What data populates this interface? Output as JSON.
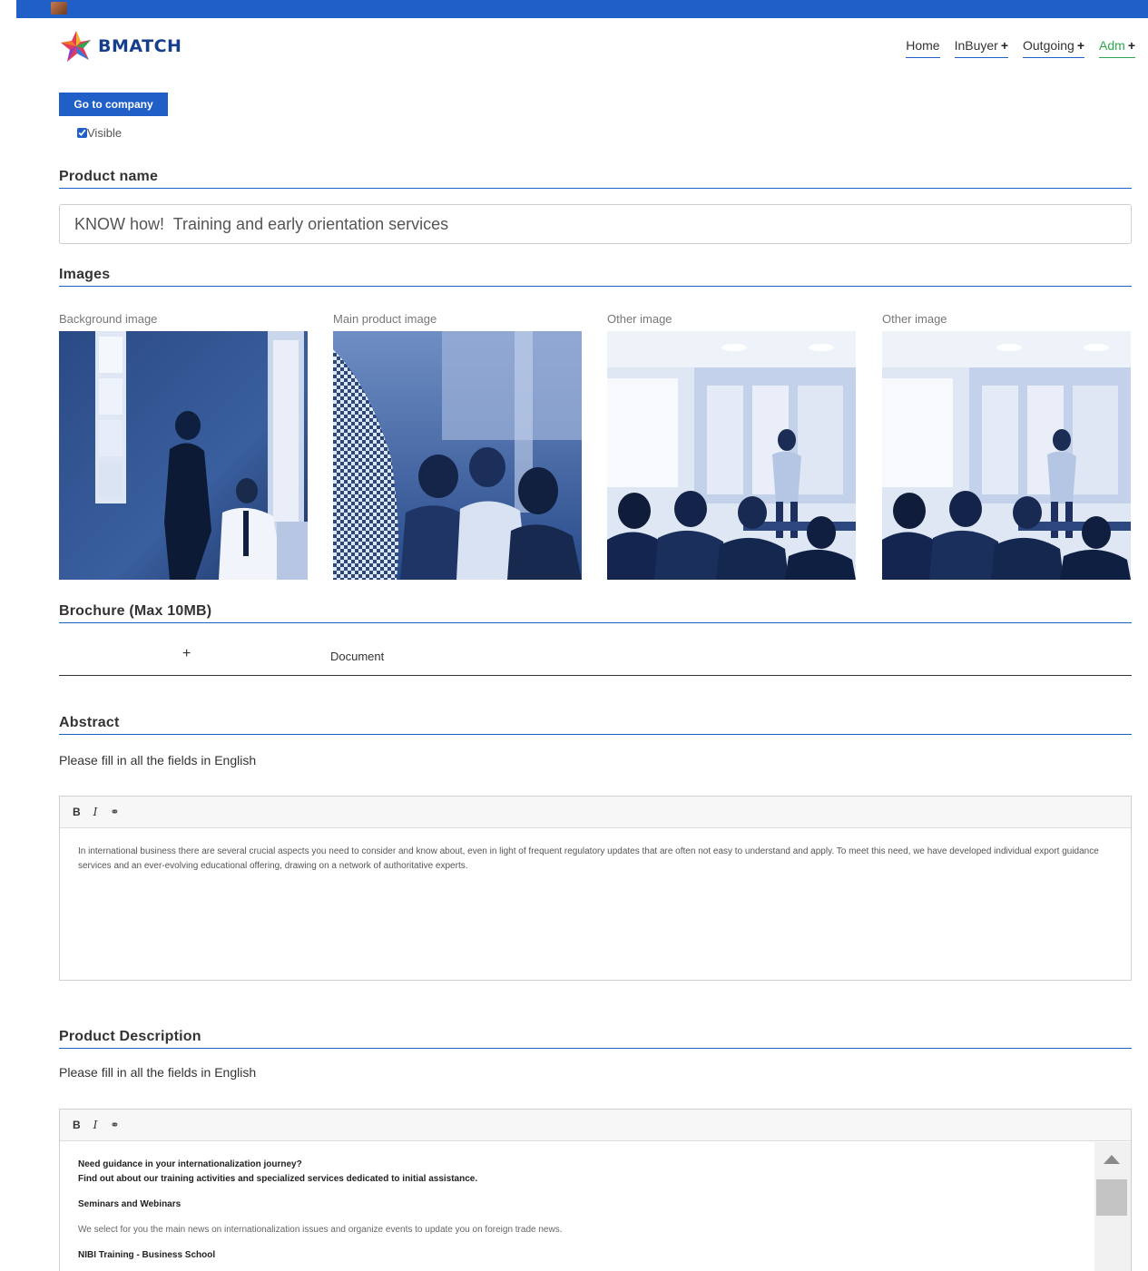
{
  "nav": {
    "logo_text": "BMATCH",
    "items": [
      {
        "label": "Home",
        "has_plus": false
      },
      {
        "label": "InBuyer",
        "has_plus": true
      },
      {
        "label": "Outgoing",
        "has_plus": true
      },
      {
        "label": "Adm",
        "has_plus": true
      }
    ],
    "plus_symbol": "+"
  },
  "actions": {
    "go_to_company": "Go to company",
    "visible_label": "Visible",
    "visible_checked": true
  },
  "product_name": {
    "title": "Product name",
    "value": "KNOW how!  Training and early orientation services"
  },
  "images": {
    "title": "Images",
    "slots": [
      {
        "label": "Background image",
        "icon": "office-meeting-photo"
      },
      {
        "label": "Main product image",
        "icon": "audience-blur-photo"
      },
      {
        "label": "Other image",
        "icon": "seminar-photo"
      },
      {
        "label": "Other image",
        "icon": "seminar-photo"
      }
    ]
  },
  "brochure": {
    "title": "Brochure (Max 10MB)",
    "add_symbol": "+",
    "document_label": "Document"
  },
  "abstract": {
    "title": "Abstract",
    "hint": "Please fill in all the fields in English",
    "toolbar": {
      "bold": "B",
      "italic": "I",
      "link": "⚭"
    },
    "text": "In international business there are several crucial aspects you need to consider and know about, even in light of frequent regulatory updates that are often not easy to understand and apply. To meet this need, we have developed individual export guidance services and an ever-evolving educational offering, drawing on a network of authoritative experts."
  },
  "description": {
    "title": "Product Description",
    "hint": "Please fill in all the fields in English",
    "toolbar": {
      "bold": "B",
      "italic": "I",
      "link": "⚭"
    },
    "line1": "Need guidance in your internationalization journey?",
    "line2": "Find out about our training activities and specialized services dedicated to initial assistance.",
    "heading1": "Seminars and Webinars",
    "para1": "We select for you the main news on internationalization issues and organize events to update you on foreign trade news.",
    "heading2": "NIBI Training - Business School"
  },
  "colors": {
    "brand_blue": "#1f5fc7",
    "accent_green": "#2ea84e",
    "logo_navy": "#173e8c"
  }
}
